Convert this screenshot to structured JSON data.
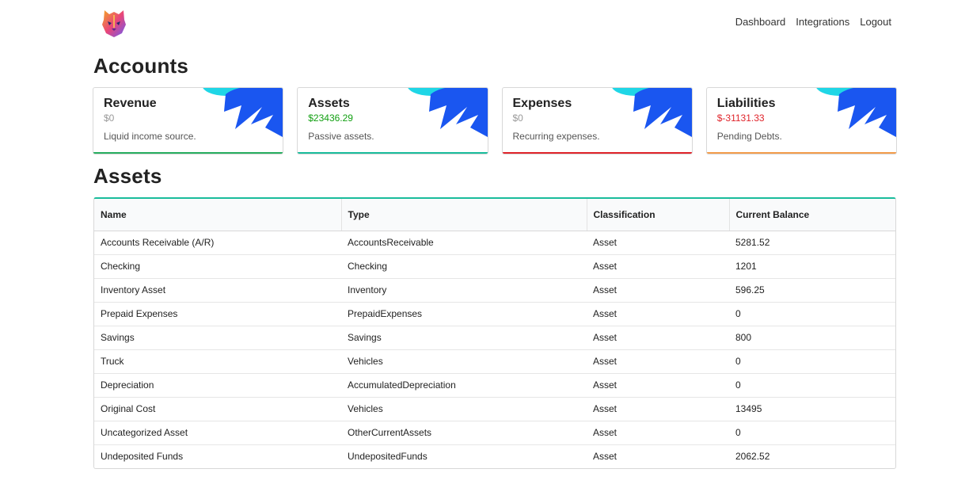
{
  "nav": {
    "items": [
      "Dashboard",
      "Integrations",
      "Logout"
    ]
  },
  "logo": {
    "icon": "tiger-logo-icon"
  },
  "accounts_section": {
    "title": "Accounts",
    "cards": [
      {
        "title": "Revenue",
        "amount": "$0",
        "description": "Liquid income source.",
        "accent": "#27ae60",
        "amount_color": "muted"
      },
      {
        "title": "Assets",
        "amount": "$23436.29",
        "description": "Passive assets.",
        "accent": "#1abc9c",
        "amount_color": "positive"
      },
      {
        "title": "Expenses",
        "amount": "$0",
        "description": "Recurring expenses.",
        "accent": "#e0242b",
        "amount_color": "muted"
      },
      {
        "title": "Liabilities",
        "amount": "$-31131.33",
        "description": "Pending Debts.",
        "accent": "#f39c4b",
        "amount_color": "negative"
      }
    ]
  },
  "assets_section": {
    "title": "Assets",
    "table": {
      "headers": [
        "Name",
        "Type",
        "Classification",
        "Current Balance"
      ],
      "rows": [
        [
          "Accounts Receivable (A/R)",
          "AccountsReceivable",
          "Asset",
          "5281.52"
        ],
        [
          "Checking",
          "Checking",
          "Asset",
          "1201"
        ],
        [
          "Inventory Asset",
          "Inventory",
          "Asset",
          "596.25"
        ],
        [
          "Prepaid Expenses",
          "PrepaidExpenses",
          "Asset",
          "0"
        ],
        [
          "Savings",
          "Savings",
          "Asset",
          "800"
        ],
        [
          "Truck",
          "Vehicles",
          "Asset",
          "0"
        ],
        [
          "Depreciation",
          "AccumulatedDepreciation",
          "Asset",
          "0"
        ],
        [
          "Original Cost",
          "Vehicles",
          "Asset",
          "13495"
        ],
        [
          "Uncategorized Asset",
          "OtherCurrentAssets",
          "Asset",
          "0"
        ],
        [
          "Undeposited Funds",
          "UndepositedFunds",
          "Asset",
          "2062.52"
        ]
      ]
    }
  },
  "colors": {
    "accent_teal": "#1abc9c",
    "positive": "#12a012",
    "negative": "#e0242b",
    "muted": "#999999",
    "deco_blue": "#1a56f0",
    "deco_cyan": "#1fd6e6"
  }
}
